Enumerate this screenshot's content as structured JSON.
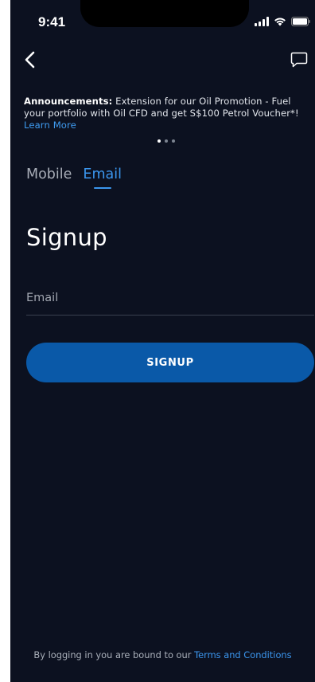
{
  "status_bar": {
    "time": "9:41"
  },
  "nav": {
    "back_icon": "chevron-left-icon",
    "chat_icon": "chat-bubble-icon"
  },
  "announcement": {
    "label": "Announcements:",
    "text": "Extension for our Oil Promotion - Fuel your portfolio with Oil CFD and get S$100 Petrol Voucher*!",
    "link": "Learn More",
    "dots_total": 3,
    "dots_active": 1
  },
  "tabs": [
    {
      "label": "Mobile",
      "active": false
    },
    {
      "label": "Email",
      "active": true
    }
  ],
  "page_title": "Signup",
  "form": {
    "email_placeholder": "Email",
    "email_value": "",
    "submit_label": "SIGNUP"
  },
  "footer": {
    "text": "By logging in you are bound to our",
    "link": "Terms and Conditions"
  },
  "colors": {
    "background": "#0c1120",
    "accent": "#3b96ee",
    "button": "#0a59a8"
  }
}
